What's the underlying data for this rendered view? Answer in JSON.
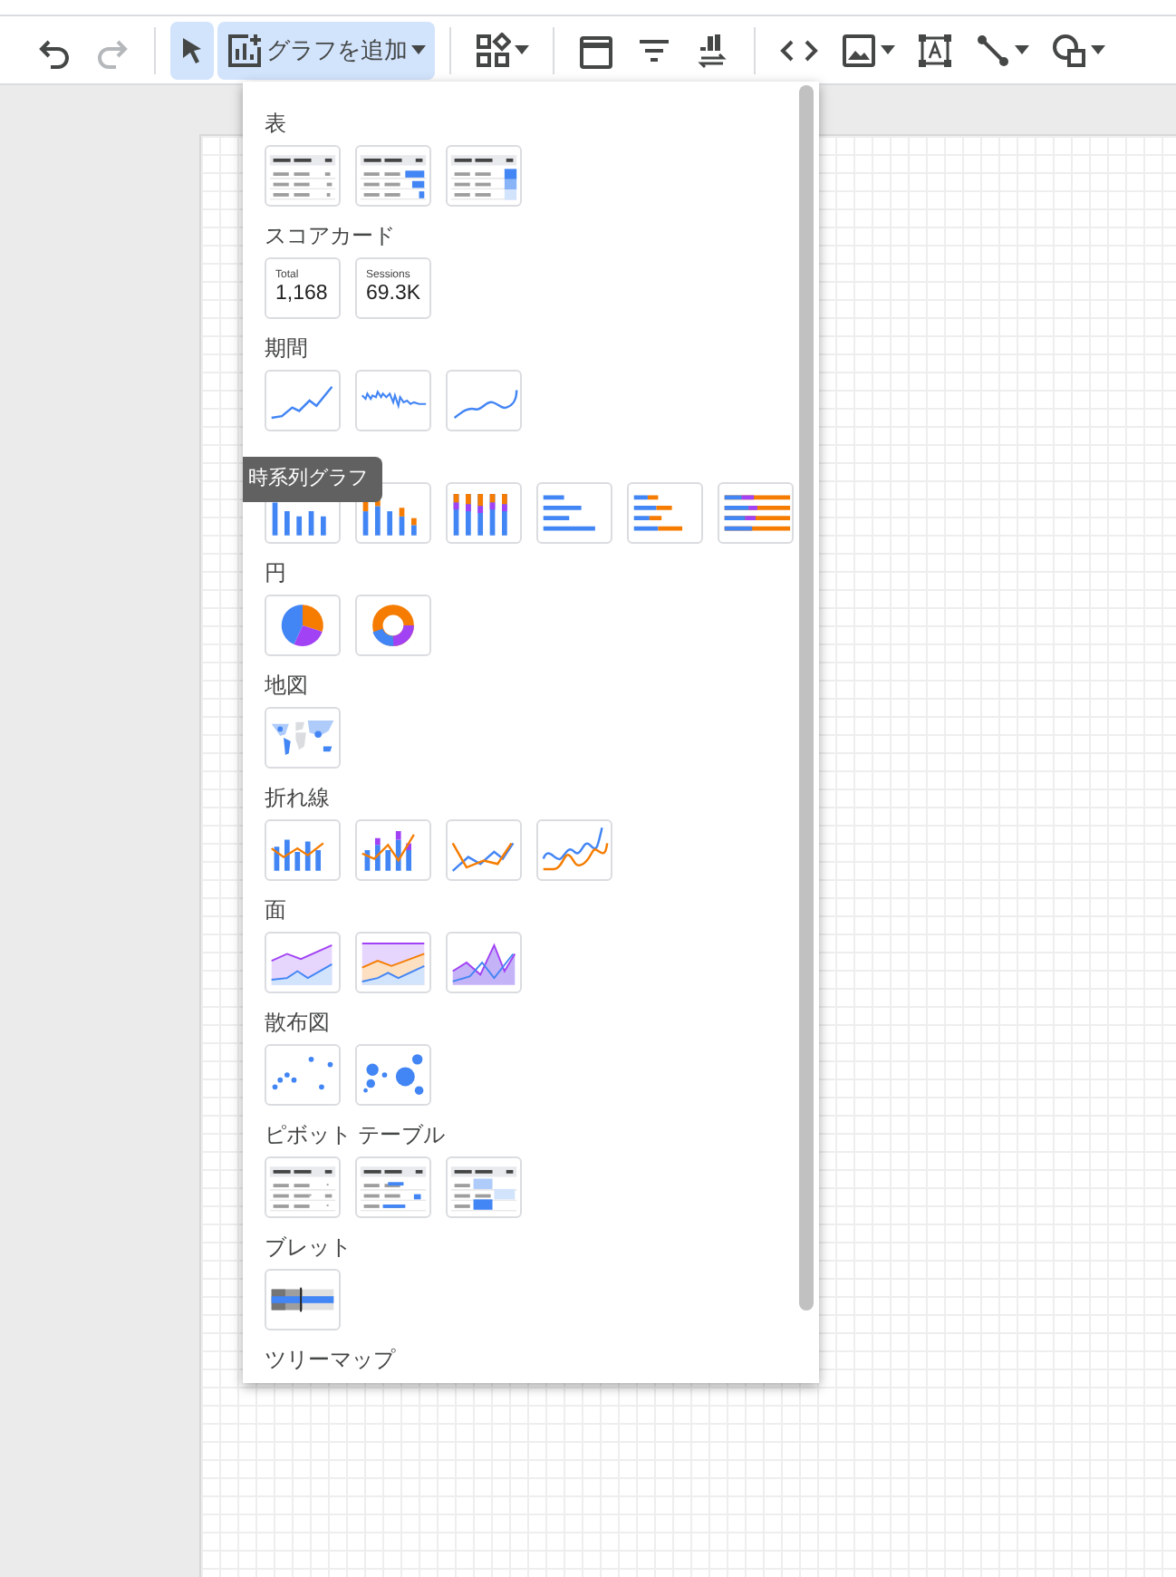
{
  "toolbar": [
    {
      "kind": "undo",
      "selected": false,
      "disabled": false
    },
    {
      "kind": "redo",
      "selected": false,
      "disabled": true
    },
    {
      "kind": "separator"
    },
    {
      "kind": "pointer",
      "selected": true,
      "disabled": false
    },
    {
      "kind": "add-chart",
      "label": "グラフを追加",
      "selected": true,
      "disabled": false
    },
    {
      "kind": "separator"
    },
    {
      "kind": "components",
      "selected": false,
      "disabled": false
    },
    {
      "kind": "separator"
    },
    {
      "kind": "calendar",
      "selected": false,
      "disabled": false
    },
    {
      "kind": "filter",
      "selected": false,
      "disabled": false
    },
    {
      "kind": "data-control",
      "selected": false,
      "disabled": false
    },
    {
      "kind": "separator"
    },
    {
      "kind": "code",
      "selected": false,
      "disabled": false
    },
    {
      "kind": "image",
      "selected": false,
      "disabled": false
    },
    {
      "kind": "textbox",
      "selected": false,
      "disabled": false
    },
    {
      "kind": "line",
      "selected": false,
      "disabled": false
    },
    {
      "kind": "shape",
      "selected": false,
      "disabled": false
    }
  ],
  "chart_menu": {
    "sections": [
      {
        "title": "表",
        "items": [
          {
            "kind": "table"
          },
          {
            "kind": "table-bars"
          },
          {
            "kind": "table-heatmap"
          }
        ]
      },
      {
        "title": "スコアカード",
        "items": [
          {
            "kind": "scorecard",
            "label": "Total",
            "value": "1,168"
          },
          {
            "kind": "scorecard",
            "label": "Sessions",
            "value": "69.3K"
          }
        ]
      },
      {
        "title": "期間",
        "items": [
          {
            "kind": "timeseries"
          },
          {
            "kind": "sparkline"
          },
          {
            "kind": "smooth-line"
          }
        ]
      },
      {
        "items": [
          {
            "kind": "column"
          },
          {
            "kind": "stacked-column"
          },
          {
            "kind": "full-stacked-column"
          },
          {
            "kind": "bar"
          },
          {
            "kind": "stacked-bar"
          },
          {
            "kind": "full-stacked-bar"
          }
        ]
      },
      {
        "title": "円",
        "items": [
          {
            "kind": "pie"
          },
          {
            "kind": "donut"
          }
        ]
      },
      {
        "title": "地図",
        "items": [
          {
            "kind": "geo-map"
          }
        ]
      },
      {
        "title": "折れ線",
        "items": [
          {
            "kind": "combo"
          },
          {
            "kind": "stacked-combo"
          },
          {
            "kind": "line"
          },
          {
            "kind": "smooth-lines"
          }
        ]
      },
      {
        "title": "面",
        "items": [
          {
            "kind": "area"
          },
          {
            "kind": "full-area"
          },
          {
            "kind": "overlap-area"
          }
        ]
      },
      {
        "title": "散布図",
        "items": [
          {
            "kind": "scatter"
          },
          {
            "kind": "bubble"
          }
        ]
      },
      {
        "title": "ピボット テーブル",
        "items": [
          {
            "kind": "pivot"
          },
          {
            "kind": "pivot-bars"
          },
          {
            "kind": "pivot-heatmap"
          }
        ]
      },
      {
        "title": "ブレット",
        "items": [
          {
            "kind": "bullet"
          }
        ]
      },
      {
        "title": "ツリーマップ"
      }
    ],
    "tooltip": "時系列グラフ"
  }
}
